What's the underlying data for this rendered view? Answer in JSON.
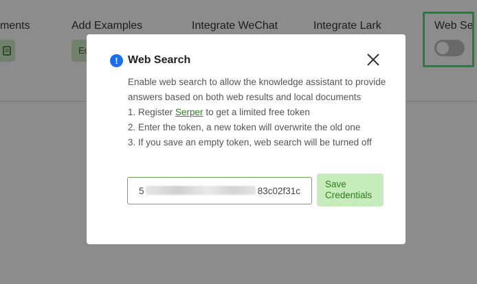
{
  "background": {
    "items": [
      {
        "label": "ments"
      },
      {
        "label": "Add Examples",
        "button": "Ec"
      },
      {
        "label": "Integrate WeChat"
      },
      {
        "label": "Integrate Lark"
      },
      {
        "label": "Web Se"
      }
    ],
    "toggle": {
      "on": false
    }
  },
  "modal": {
    "title": "Web Search",
    "description": "Enable web search to allow the knowledge assistant to provide answers based on both web results and local documents",
    "step1_prefix": "1. Register ",
    "step1_link": "Serper",
    "step1_suffix": " to get a limited free token",
    "step2": "2. Enter the token, a new token will overwrite the old one",
    "step3": "3. If you save an empty token, web search will be turned off",
    "token_prefix": "5",
    "token_suffix": "83c02f31c",
    "save_label": "Save Credentials"
  },
  "colors": {
    "accent": "#1a6ef5",
    "save_bg": "#c6ecbb",
    "highlight": "#3ee86a"
  }
}
